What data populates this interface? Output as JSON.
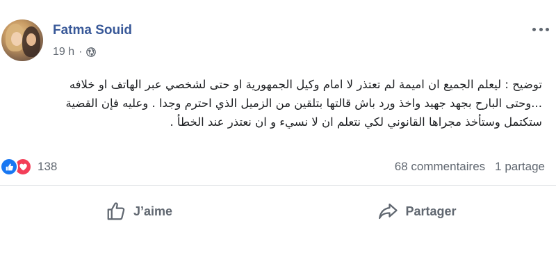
{
  "post": {
    "author": "Fatma Souid",
    "time": "19 h",
    "separator": "·",
    "privacy_icon": "globe-icon",
    "more_icon": "more-horizontal-icon",
    "text_lines": [
      "توضيح : ليعلم الجميع ان اميمة لم تعتذر لا امام وكيل الجمهورية او حتى لشخصي عبر الهاتف او خلافه",
      "...وحتى البارح بجهد جهيد واخذ ورد باش قالتها بتلقين من الزميل الذي احترم وجدا . وعليه فإن القضية",
      "ستكتمل وستأخذ مجراها القانوني لكي نتعلم ان لا نسيء و ان نعتذر عند الخطأ ."
    ]
  },
  "reactions": {
    "icons": [
      "like-icon",
      "love-icon"
    ],
    "count": "138",
    "colors": {
      "like": "#1877f2",
      "love": "#f33e58"
    }
  },
  "stats": {
    "comments": "68 commentaires",
    "shares": "1 partage"
  },
  "actions": {
    "like_label": "J’aime",
    "share_label": "Partager"
  },
  "colors": {
    "author": "#385898",
    "secondary_text": "#606770",
    "divider": "#dadde1"
  }
}
